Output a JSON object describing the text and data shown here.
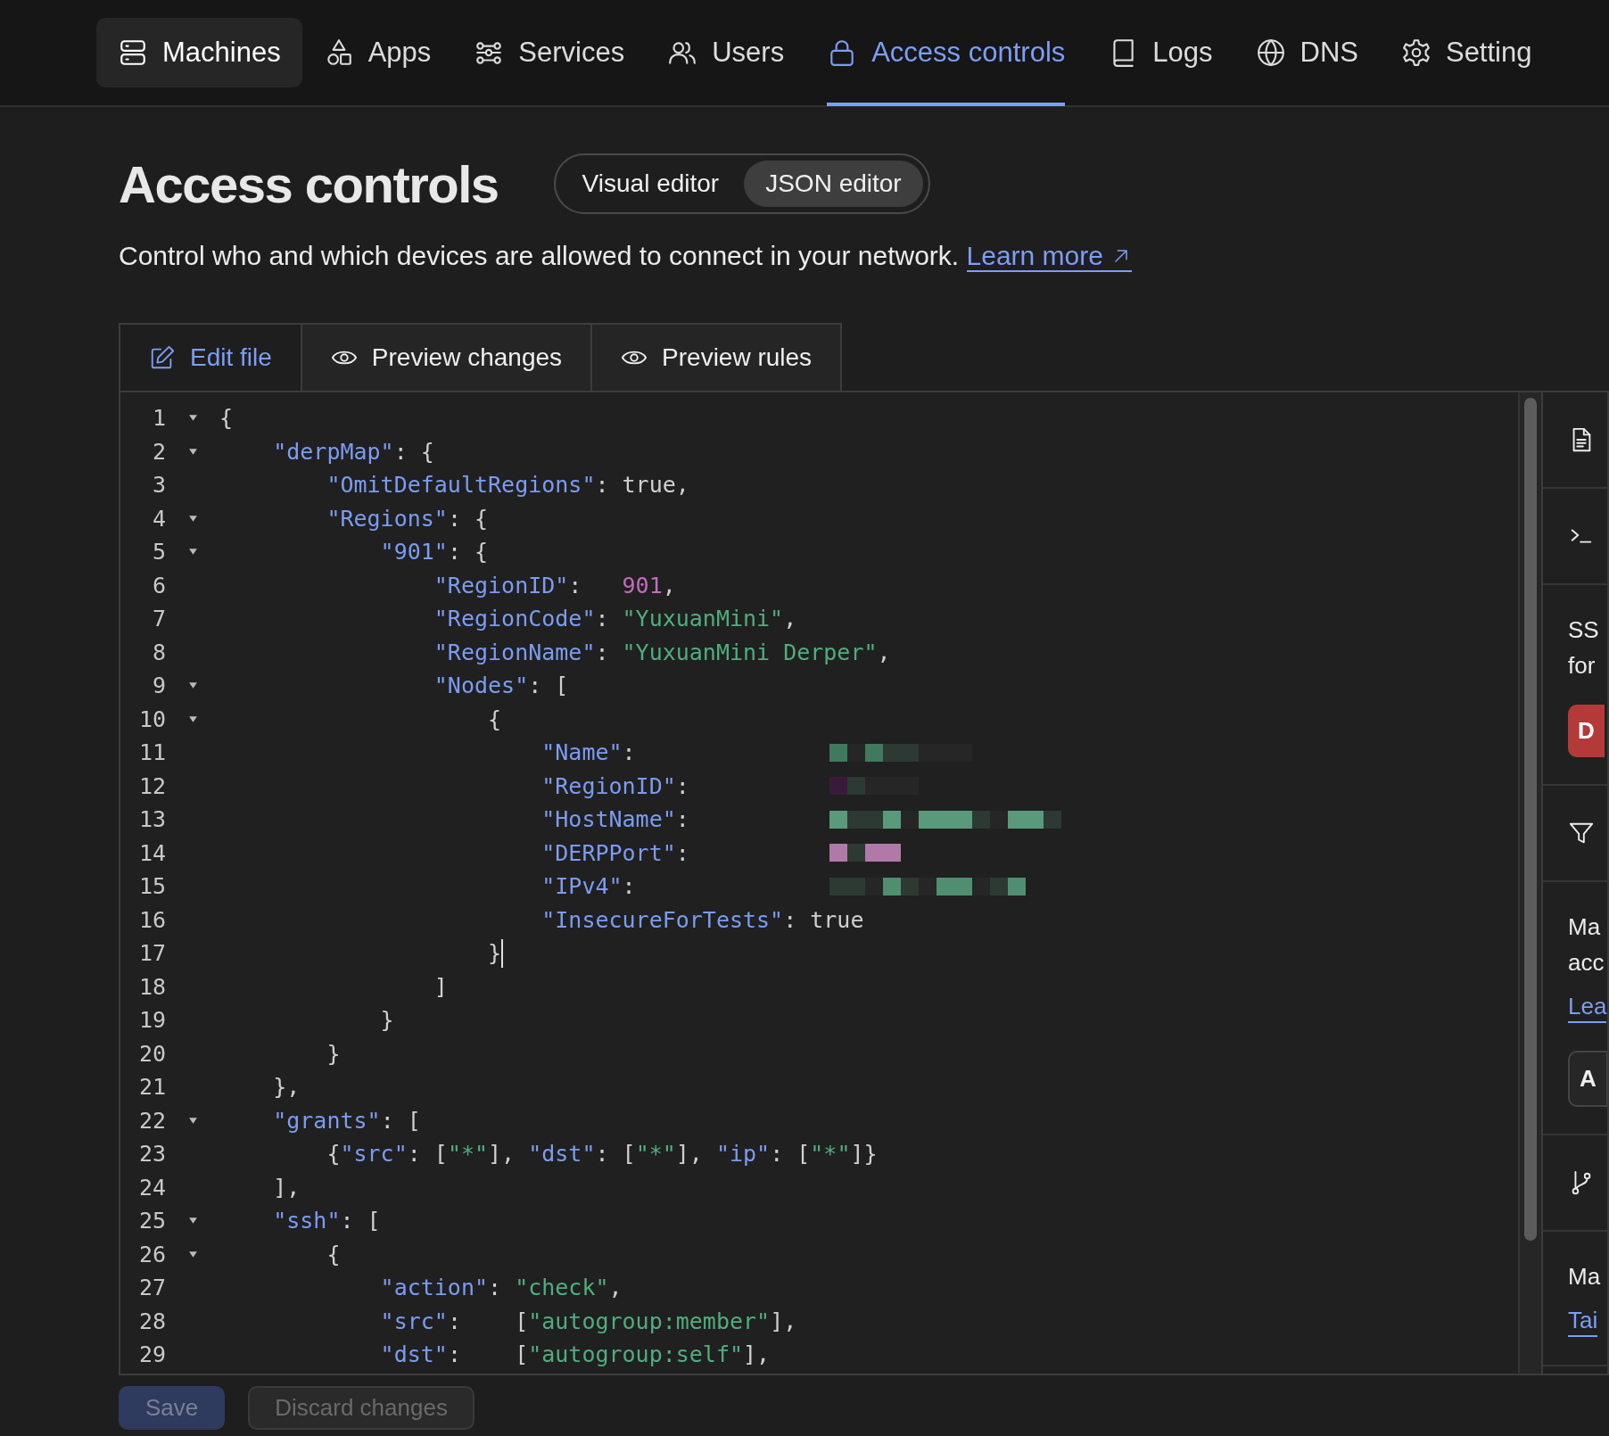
{
  "nav": {
    "items": [
      {
        "label": "Machines",
        "selected": false,
        "highlighted": true
      },
      {
        "label": "Apps",
        "selected": false,
        "highlighted": false
      },
      {
        "label": "Services",
        "selected": false,
        "highlighted": false
      },
      {
        "label": "Users",
        "selected": false,
        "highlighted": false
      },
      {
        "label": "Access controls",
        "selected": true,
        "highlighted": false
      },
      {
        "label": "Logs",
        "selected": false,
        "highlighted": false
      },
      {
        "label": "DNS",
        "selected": false,
        "highlighted": false
      },
      {
        "label": "Setting",
        "selected": false,
        "highlighted": false
      }
    ]
  },
  "header": {
    "title": "Access controls",
    "mode_toggle": [
      {
        "label": "Visual editor",
        "selected": false
      },
      {
        "label": "JSON editor",
        "selected": true
      }
    ],
    "description": {
      "text": "Control who and which devices are allowed to connect in your network. ",
      "link": "Learn more"
    }
  },
  "editor_tabs": [
    {
      "label": "Edit file",
      "selected": true
    },
    {
      "label": "Preview changes",
      "selected": false
    },
    {
      "label": "Preview rules",
      "selected": false
    }
  ],
  "code_lines": [
    {
      "number": "1",
      "foldable": true,
      "cursor": false,
      "tokens": [
        {
          "kind": "punct",
          "text": "{"
        }
      ]
    },
    {
      "number": "2",
      "foldable": true,
      "cursor": false,
      "tokens": [
        {
          "kind": "key",
          "text": "    \"derpMap\""
        },
        {
          "kind": "punct",
          "text": ": {"
        }
      ]
    },
    {
      "number": "3",
      "foldable": false,
      "cursor": false,
      "tokens": [
        {
          "kind": "key",
          "text": "        \"OmitDefaultRegions\""
        },
        {
          "kind": "punct",
          "text": ": true,"
        }
      ]
    },
    {
      "number": "4",
      "foldable": true,
      "cursor": false,
      "tokens": [
        {
          "kind": "key",
          "text": "        \"Regions\""
        },
        {
          "kind": "punct",
          "text": ": {"
        }
      ]
    },
    {
      "number": "5",
      "foldable": true,
      "cursor": false,
      "tokens": [
        {
          "kind": "key",
          "text": "            \"901\""
        },
        {
          "kind": "punct",
          "text": ": {"
        }
      ]
    },
    {
      "number": "6",
      "foldable": false,
      "cursor": false,
      "tokens": [
        {
          "kind": "key",
          "text": "                \"RegionID\""
        },
        {
          "kind": "punct",
          "text": ":   "
        },
        {
          "kind": "number",
          "text": "901"
        },
        {
          "kind": "punct",
          "text": ","
        }
      ]
    },
    {
      "number": "7",
      "foldable": false,
      "cursor": false,
      "tokens": [
        {
          "kind": "key",
          "text": "                \"RegionCode\""
        },
        {
          "kind": "punct",
          "text": ": "
        },
        {
          "kind": "string",
          "text": "\"YuxuanMini\""
        },
        {
          "kind": "punct",
          "text": ","
        }
      ]
    },
    {
      "number": "8",
      "foldable": false,
      "cursor": false,
      "tokens": [
        {
          "kind": "key",
          "text": "                \"RegionName\""
        },
        {
          "kind": "punct",
          "text": ": "
        },
        {
          "kind": "string",
          "text": "\"YuxuanMini Derper\""
        },
        {
          "kind": "punct",
          "text": ","
        }
      ]
    },
    {
      "number": "9",
      "foldable": true,
      "cursor": false,
      "tokens": [
        {
          "kind": "key",
          "text": "                \"Nodes\""
        },
        {
          "kind": "punct",
          "text": ": ["
        }
      ]
    },
    {
      "number": "10",
      "foldable": true,
      "cursor": false,
      "tokens": [
        {
          "kind": "punct",
          "text": "                    {"
        }
      ]
    },
    {
      "number": "11",
      "foldable": false,
      "cursor": false,
      "tokens": [
        {
          "kind": "key",
          "text": "                        \"Name\""
        },
        {
          "kind": "punct",
          "text": ":"
        }
      ],
      "redaction": {
        "color": "#3f7a5c"
      }
    },
    {
      "number": "12",
      "foldable": false,
      "cursor": false,
      "tokens": [
        {
          "kind": "key",
          "text": "                        \"RegionID\""
        },
        {
          "kind": "punct",
          "text": ":"
        }
      ],
      "redaction": {
        "color": "#3a1a3a"
      }
    },
    {
      "number": "13",
      "foldable": false,
      "cursor": false,
      "tokens": [
        {
          "kind": "key",
          "text": "                        \"HostName\""
        },
        {
          "kind": "punct",
          "text": ":"
        }
      ],
      "redaction": {
        "color": "#5a9a7c"
      }
    },
    {
      "number": "14",
      "foldable": false,
      "cursor": false,
      "tokens": [
        {
          "kind": "key",
          "text": "                        \"DERPPort\""
        },
        {
          "kind": "punct",
          "text": ":"
        }
      ],
      "redaction": {
        "color": "#b07aa8"
      }
    },
    {
      "number": "15",
      "foldable": false,
      "cursor": false,
      "tokens": [
        {
          "kind": "key",
          "text": "                        \"IPv4\""
        },
        {
          "kind": "punct",
          "text": ":"
        }
      ],
      "redaction": {
        "color": "#4f8f70"
      }
    },
    {
      "number": "16",
      "foldable": false,
      "cursor": false,
      "tokens": [
        {
          "kind": "key",
          "text": "                        \"InsecureForTests\""
        },
        {
          "kind": "punct",
          "text": ": true"
        }
      ]
    },
    {
      "number": "17",
      "foldable": false,
      "cursor": true,
      "tokens": [
        {
          "kind": "punct",
          "text": "                    }"
        }
      ]
    },
    {
      "number": "18",
      "foldable": false,
      "cursor": false,
      "tokens": [
        {
          "kind": "punct",
          "text": "                ]"
        }
      ]
    },
    {
      "number": "19",
      "foldable": false,
      "cursor": false,
      "tokens": [
        {
          "kind": "punct",
          "text": "            }"
        }
      ]
    },
    {
      "number": "20",
      "foldable": false,
      "cursor": false,
      "tokens": [
        {
          "kind": "punct",
          "text": "        }"
        }
      ]
    },
    {
      "number": "21",
      "foldable": false,
      "cursor": false,
      "tokens": [
        {
          "kind": "punct",
          "text": "    },"
        }
      ]
    },
    {
      "number": "22",
      "foldable": true,
      "cursor": false,
      "tokens": [
        {
          "kind": "key",
          "text": "    \"grants\""
        },
        {
          "kind": "punct",
          "text": ": ["
        }
      ]
    },
    {
      "number": "23",
      "foldable": false,
      "cursor": false,
      "tokens": [
        {
          "kind": "punct",
          "text": "        {"
        },
        {
          "kind": "key",
          "text": "\"src\""
        },
        {
          "kind": "punct",
          "text": ": ["
        },
        {
          "kind": "string",
          "text": "\"*\""
        },
        {
          "kind": "punct",
          "text": "], "
        },
        {
          "kind": "key",
          "text": "\"dst\""
        },
        {
          "kind": "punct",
          "text": ": ["
        },
        {
          "kind": "string",
          "text": "\"*\""
        },
        {
          "kind": "punct",
          "text": "], "
        },
        {
          "kind": "key",
          "text": "\"ip\""
        },
        {
          "kind": "punct",
          "text": ": ["
        },
        {
          "kind": "string",
          "text": "\"*\""
        },
        {
          "kind": "punct",
          "text": "]}"
        }
      ]
    },
    {
      "number": "24",
      "foldable": false,
      "cursor": false,
      "tokens": [
        {
          "kind": "punct",
          "text": "    ],"
        }
      ]
    },
    {
      "number": "25",
      "foldable": true,
      "cursor": false,
      "tokens": [
        {
          "kind": "key",
          "text": "    \"ssh\""
        },
        {
          "kind": "punct",
          "text": ": ["
        }
      ]
    },
    {
      "number": "26",
      "foldable": true,
      "cursor": false,
      "tokens": [
        {
          "kind": "punct",
          "text": "        {"
        }
      ]
    },
    {
      "number": "27",
      "foldable": false,
      "cursor": false,
      "tokens": [
        {
          "kind": "key",
          "text": "            \"action\""
        },
        {
          "kind": "punct",
          "text": ": "
        },
        {
          "kind": "string",
          "text": "\"check\""
        },
        {
          "kind": "punct",
          "text": ","
        }
      ]
    },
    {
      "number": "28",
      "foldable": false,
      "cursor": false,
      "tokens": [
        {
          "kind": "key",
          "text": "            \"src\""
        },
        {
          "kind": "punct",
          "text": ":    ["
        },
        {
          "kind": "string",
          "text": "\"autogroup:member\""
        },
        {
          "kind": "punct",
          "text": "],"
        }
      ]
    },
    {
      "number": "29",
      "foldable": false,
      "cursor": false,
      "tokens": [
        {
          "kind": "key",
          "text": "            \"dst\""
        },
        {
          "kind": "punct",
          "text": ":    ["
        },
        {
          "kind": "string",
          "text": "\"autogroup:self\""
        },
        {
          "kind": "punct",
          "text": "],"
        }
      ]
    }
  ],
  "side_panel": [
    {
      "kind": "icon"
    },
    {
      "kind": "icon"
    },
    {
      "kind": "text",
      "lines": [
        "SS",
        "for"
      ],
      "button": {
        "label": "D",
        "kind": "danger"
      }
    },
    {
      "kind": "icon"
    },
    {
      "kind": "text",
      "lines": [
        "Ma",
        "acc"
      ],
      "link": "Lea",
      "button": {
        "label": "A",
        "kind": "outline"
      }
    },
    {
      "kind": "icon"
    },
    {
      "kind": "text",
      "lines": [
        "Ma"
      ],
      "link": "Tai"
    }
  ],
  "actions": [
    {
      "label": "Save",
      "kind": "primary",
      "disabled": true
    },
    {
      "label": "Discard changes",
      "kind": "secondary",
      "disabled": true
    }
  ]
}
